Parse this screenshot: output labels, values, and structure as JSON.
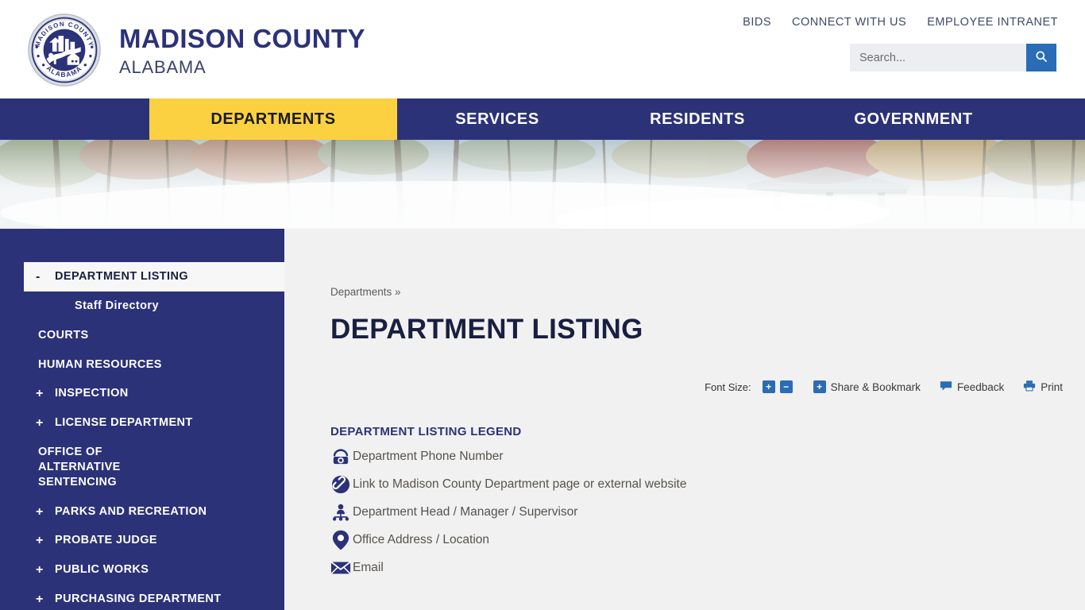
{
  "header": {
    "logo_icon": "madison-county-seal",
    "brand_line1": "MADISON COUNTY",
    "brand_line2": "ALABAMA",
    "utility_links": [
      {
        "label": "BIDS"
      },
      {
        "label": "CONNECT WITH US"
      },
      {
        "label": "EMPLOYEE INTRANET"
      }
    ],
    "search": {
      "placeholder": "Search...",
      "value": "",
      "button_icon": "search-icon"
    }
  },
  "mainnav": {
    "items": [
      {
        "label": "DEPARTMENTS",
        "active": true
      },
      {
        "label": "SERVICES",
        "active": false
      },
      {
        "label": "RESIDENTS",
        "active": false
      },
      {
        "label": "GOVERNMENT",
        "active": false
      }
    ]
  },
  "banner": {
    "alt": "Misty autumn forest with pavilion over water"
  },
  "sidebar": {
    "items": [
      {
        "label": "DEPARTMENT LISTING",
        "toggle": "-",
        "active": true,
        "sub": false
      },
      {
        "label": "Staff Directory",
        "toggle": "",
        "active": false,
        "sub": true
      },
      {
        "label": "COURTS",
        "toggle": "",
        "active": false,
        "sub": false
      },
      {
        "label": "HUMAN RESOURCES",
        "toggle": "",
        "active": false,
        "sub": false
      },
      {
        "label": "INSPECTION",
        "toggle": "+",
        "active": false,
        "sub": false
      },
      {
        "label": "LICENSE DEPARTMENT",
        "toggle": "+",
        "active": false,
        "sub": false
      },
      {
        "label": "OFFICE OF ALTERNATIVE SENTENCING",
        "toggle": "",
        "active": false,
        "sub": false
      },
      {
        "label": "PARKS AND RECREATION",
        "toggle": "+",
        "active": false,
        "sub": false
      },
      {
        "label": "PROBATE JUDGE",
        "toggle": "+",
        "active": false,
        "sub": false
      },
      {
        "label": "PUBLIC WORKS",
        "toggle": "+",
        "active": false,
        "sub": false
      },
      {
        "label": "PURCHASING DEPARTMENT",
        "toggle": "+",
        "active": false,
        "sub": false
      }
    ]
  },
  "content": {
    "breadcrumb": "Departments »",
    "title": "DEPARTMENT LISTING",
    "tools": {
      "font_size_label": "Font Size:",
      "font_increase": "+",
      "font_decrease": "−",
      "share_plus": "+",
      "share_label": "Share & Bookmark",
      "feedback_label": "Feedback",
      "print_label": "Print"
    },
    "legend": {
      "title": "DEPARTMENT LISTING LEGEND",
      "rows": [
        {
          "icon": "telephone-icon",
          "label": "Department Phone Number"
        },
        {
          "icon": "link-icon",
          "label": "Link to Madison County Department page or external website"
        },
        {
          "icon": "person-org-icon",
          "label": "Department Head / Manager / Supervisor"
        },
        {
          "icon": "map-pin-icon",
          "label": "Office Address / Location"
        },
        {
          "icon": "envelope-icon",
          "label": "Email"
        }
      ]
    }
  },
  "colors": {
    "navy": "#2b3278",
    "yellow": "#fbd142",
    "accent_blue": "#2a6cb5",
    "page_bg": "#f1f1f1"
  }
}
